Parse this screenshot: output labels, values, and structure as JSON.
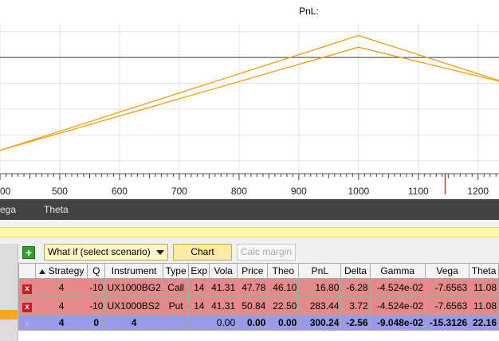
{
  "chart_panel": {
    "title": "PnL:"
  },
  "chart_data": {
    "type": "line",
    "title": "PnL:",
    "x_ticks": [
      "00",
      "500",
      "600",
      "700",
      "800",
      "900",
      "1000",
      "1100",
      "1200"
    ],
    "series": [
      {
        "color": "#f39c12",
        "x": [
          400,
          1000,
          1250
        ],
        "y": [
          -72,
          17,
          -20
        ]
      },
      {
        "color": "#f39c12",
        "x": [
          400,
          1000,
          1250
        ],
        "y": [
          -72,
          8,
          -20
        ]
      }
    ],
    "xlim": [
      400,
      1235
    ],
    "hline": 0,
    "marker_x": 1145,
    "grid": true
  },
  "greeks_bar": {
    "labels": [
      "ega",
      "Theta"
    ]
  },
  "toolbar": {
    "add_label": "+",
    "scenario_label": "What if (select scenario)",
    "chart_label": "Chart",
    "calc_margin_label": "Calc margin"
  },
  "table": {
    "columns": [
      "",
      "Strategy",
      "Q",
      "Instrument",
      "Type",
      "Exp",
      "Vola",
      "Price",
      "Theo",
      "PnL",
      "Delta",
      "Gamma",
      "Vega",
      "Theta"
    ],
    "rows": [
      [
        "x",
        "4",
        "-10",
        "UX1000BG2",
        "Call",
        "14",
        "41.31",
        "47.78",
        "46.10",
        "16.80",
        "-6.28",
        "-4.524e-02",
        "-7.6563",
        "11.08"
      ],
      [
        "x",
        "4",
        "-10",
        "UX1000BS2",
        "Put",
        "14",
        "41.31",
        "50.84",
        "22.50",
        "283.44",
        "3.72",
        "-4.524e-02",
        "-7.6563",
        "11.08"
      ]
    ],
    "total": [
      "x",
      "4",
      "0",
      "4",
      "",
      "",
      "0.00",
      "0.00",
      "0.00",
      "300.24",
      "-2.56",
      "-9.048e-02",
      "-15.3126",
      "22.16"
    ]
  },
  "colors": {
    "accent": "#f39c12",
    "row_red": "#e58a8a",
    "row_total": "#9a9ae6",
    "dark_bar": "#424242",
    "yellow_stripe": "#fff7b0"
  }
}
